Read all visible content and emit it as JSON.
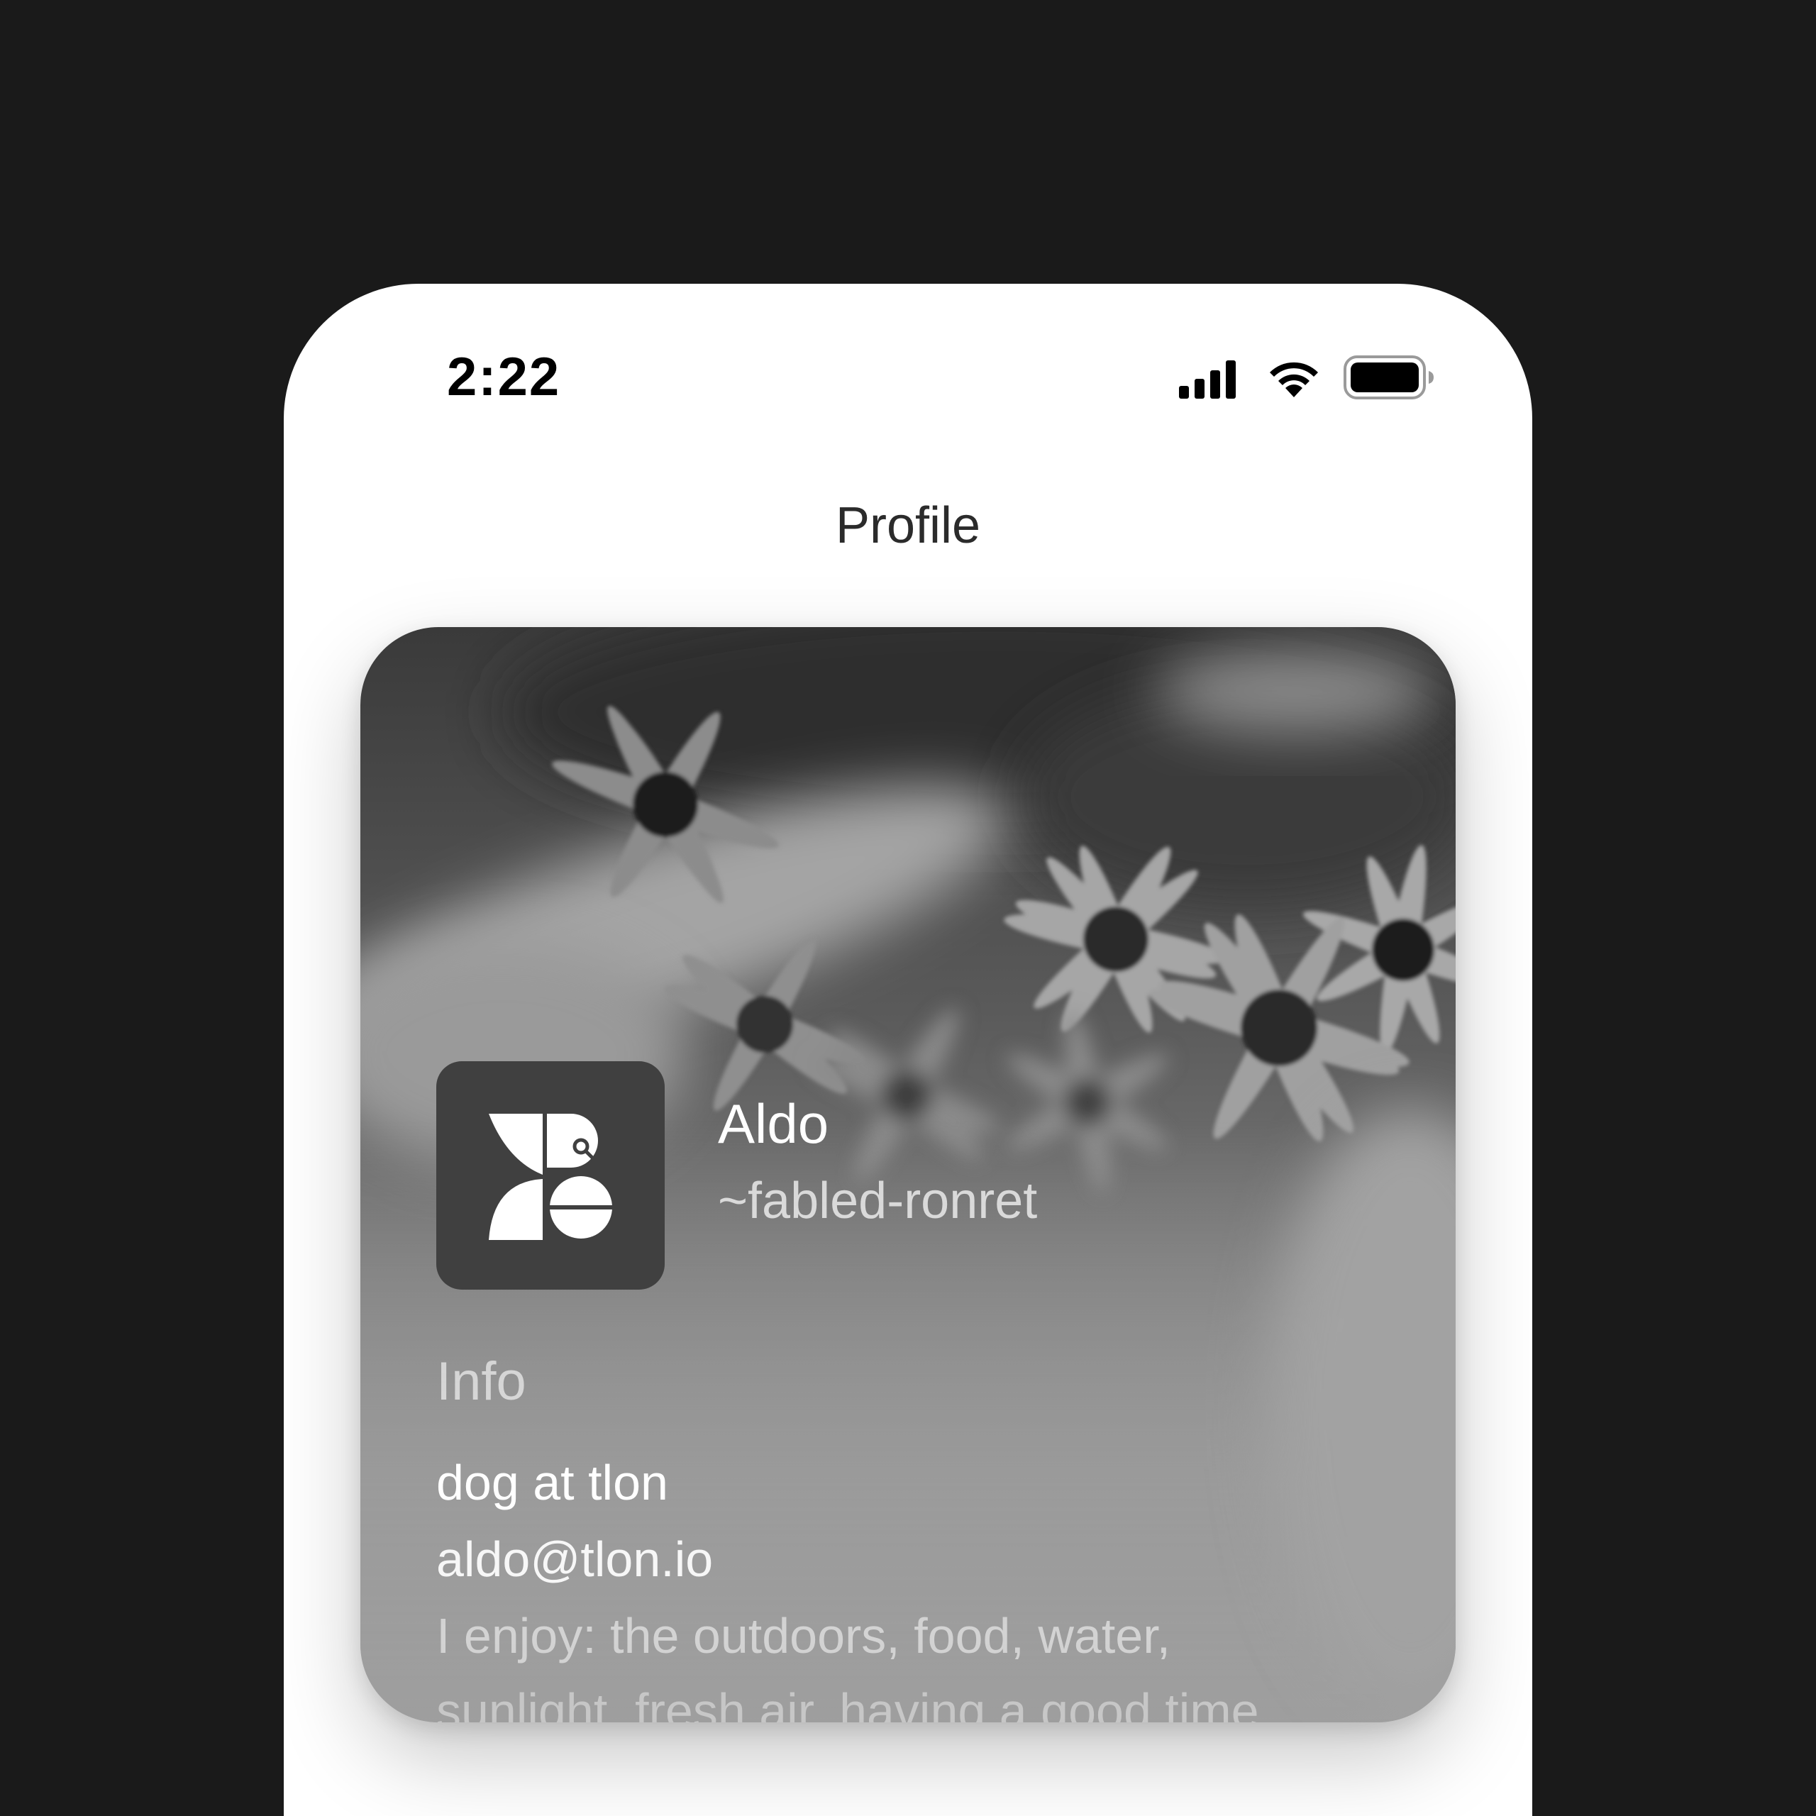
{
  "status_bar": {
    "time": "2:22",
    "icons": [
      "cellular-signal-icon",
      "wifi-icon",
      "battery-icon"
    ]
  },
  "header": {
    "title": "Profile"
  },
  "profile_card": {
    "avatar": {
      "icon": "tlon-logo-icon"
    },
    "name": "Aldo",
    "handle": "~fabled-ronret",
    "info": {
      "label": "Info",
      "title": "dog at tlon",
      "email": "aldo@tlon.io",
      "bio_line_1": "I enjoy: the outdoors, food, water,",
      "bio_line_2": "sunlight, fresh air, having a good time"
    }
  },
  "colors": {
    "page_background": "#1a1a1a",
    "screen_background": "#ffffff",
    "avatar_background": "#404040"
  }
}
